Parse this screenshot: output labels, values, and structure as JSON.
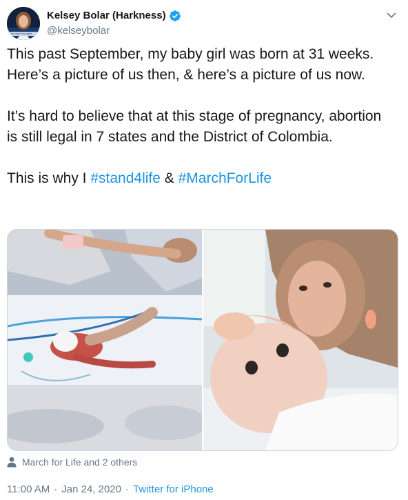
{
  "author": {
    "name": "Kelsey Bolar (Harkness)",
    "handle": "@kelseybolar",
    "verified": true,
    "avatar_caption": "YOU WANT TO DEBAT"
  },
  "tweet": {
    "paragraph1": "This past September, my baby girl was born at 31 weeks. Here’s a picture of us then, & here’s a picture of us now.",
    "paragraph2": "It’s hard to believe that at this stage of pregnancy, abortion is still legal in 7 states and the District of Colombia.",
    "paragraph3_prefix": "This is why I ",
    "hashtag1": "#stand4life",
    "paragraph3_mid": " & ",
    "hashtag2": "#MarchForLife"
  },
  "media": {
    "photo_left": "nicu-incubator-photo",
    "photo_right": "mother-and-baby-photo"
  },
  "tagged": {
    "text": "March for Life and 2 others"
  },
  "meta": {
    "time": "11:00 AM",
    "separator": "·",
    "date": "Jan 24, 2020",
    "source": "Twitter for iPhone"
  },
  "colors": {
    "text": "#14171a",
    "secondary": "#657786",
    "link": "#1b95e0",
    "verified": "#1da1f2"
  }
}
